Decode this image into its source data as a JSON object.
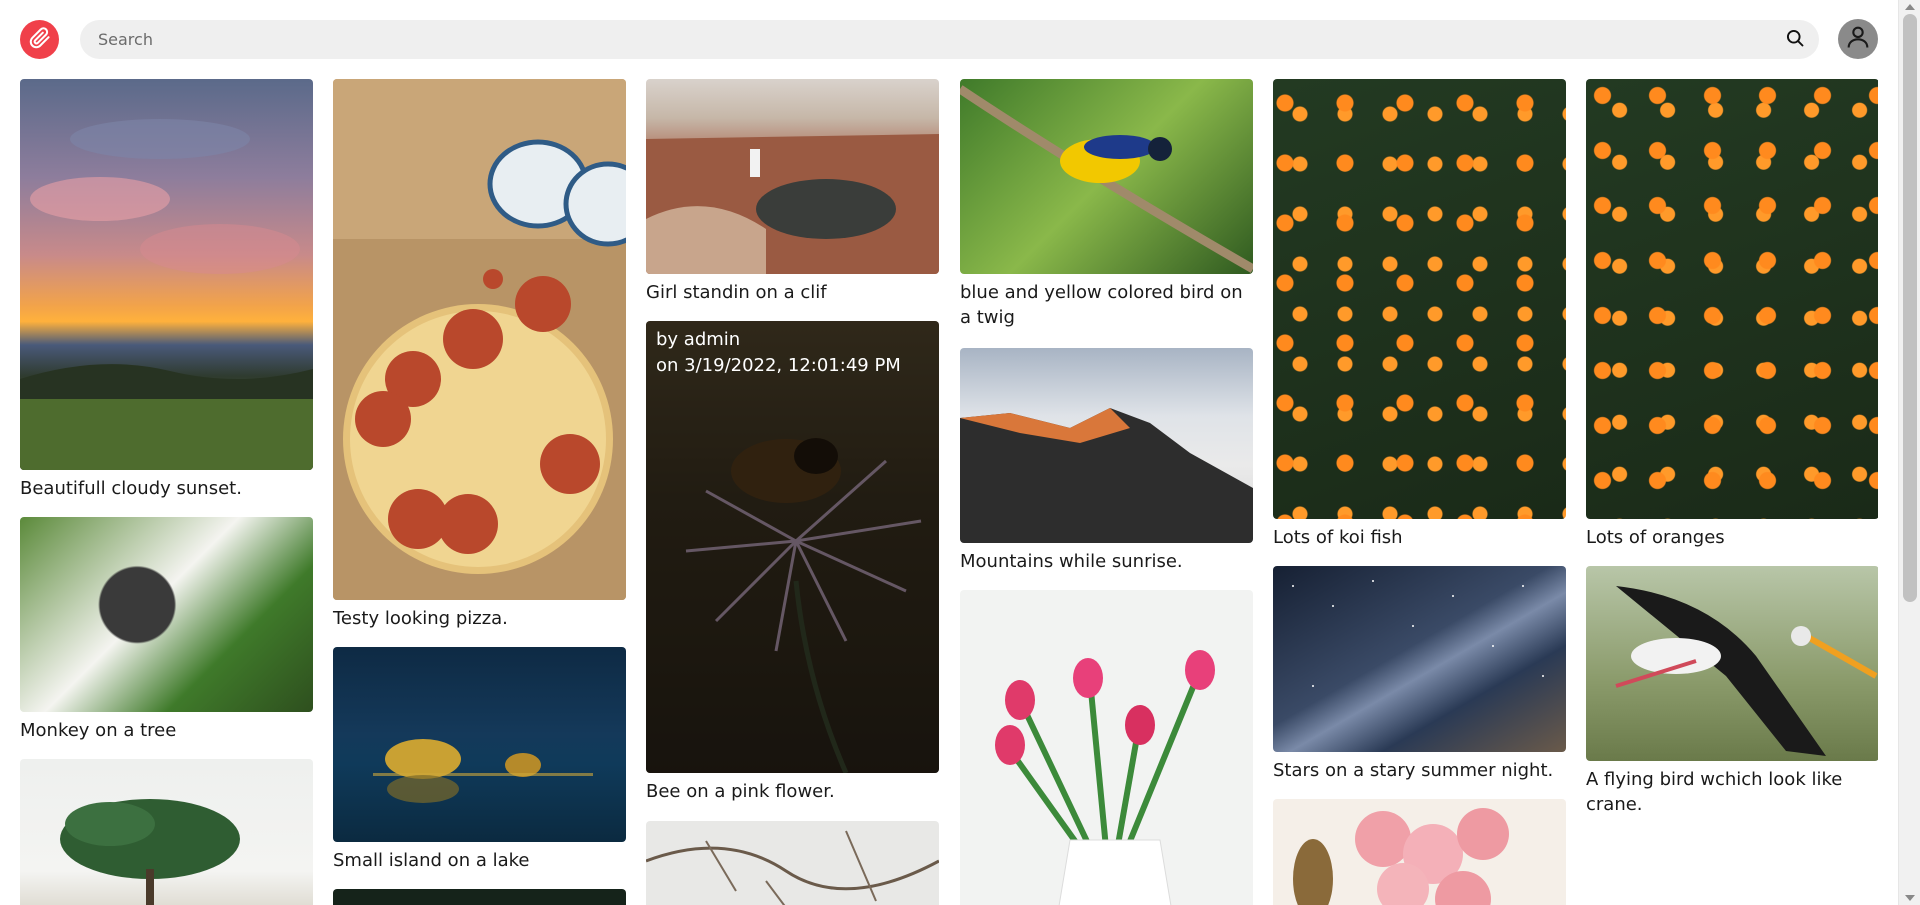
{
  "header": {
    "search_placeholder": "Search"
  },
  "icons": {
    "logo": "paperclip-icon",
    "search": "search-icon",
    "user": "user-icon"
  },
  "colors": {
    "brand": "#f0404a",
    "search_bg": "#efefef",
    "avatar_bg": "#8a8a8a"
  },
  "posts": [
    {
      "caption": "Beautifull cloudy sunset."
    },
    {
      "caption": "Monkey on a tree"
    },
    {
      "caption": ""
    },
    {
      "caption": "Testy looking pizza."
    },
    {
      "caption": "Small island on a lake"
    },
    {
      "caption": ""
    },
    {
      "caption": "Girl standin on a clif"
    },
    {
      "caption": "Bee on a pink flower.",
      "author": "by admin",
      "date": "on 3/19/2022, 12:01:49 PM"
    },
    {
      "caption": ""
    },
    {
      "caption": "blue and yellow colored bird on a twig"
    },
    {
      "caption": "Mountains while sunrise."
    },
    {
      "caption": ""
    },
    {
      "caption": "Lots of koi fish"
    },
    {
      "caption": "Stars on a stary summer night."
    },
    {
      "caption": ""
    },
    {
      "caption": "Lots of oranges"
    },
    {
      "caption": "A flying bird wchich look like crane."
    }
  ]
}
